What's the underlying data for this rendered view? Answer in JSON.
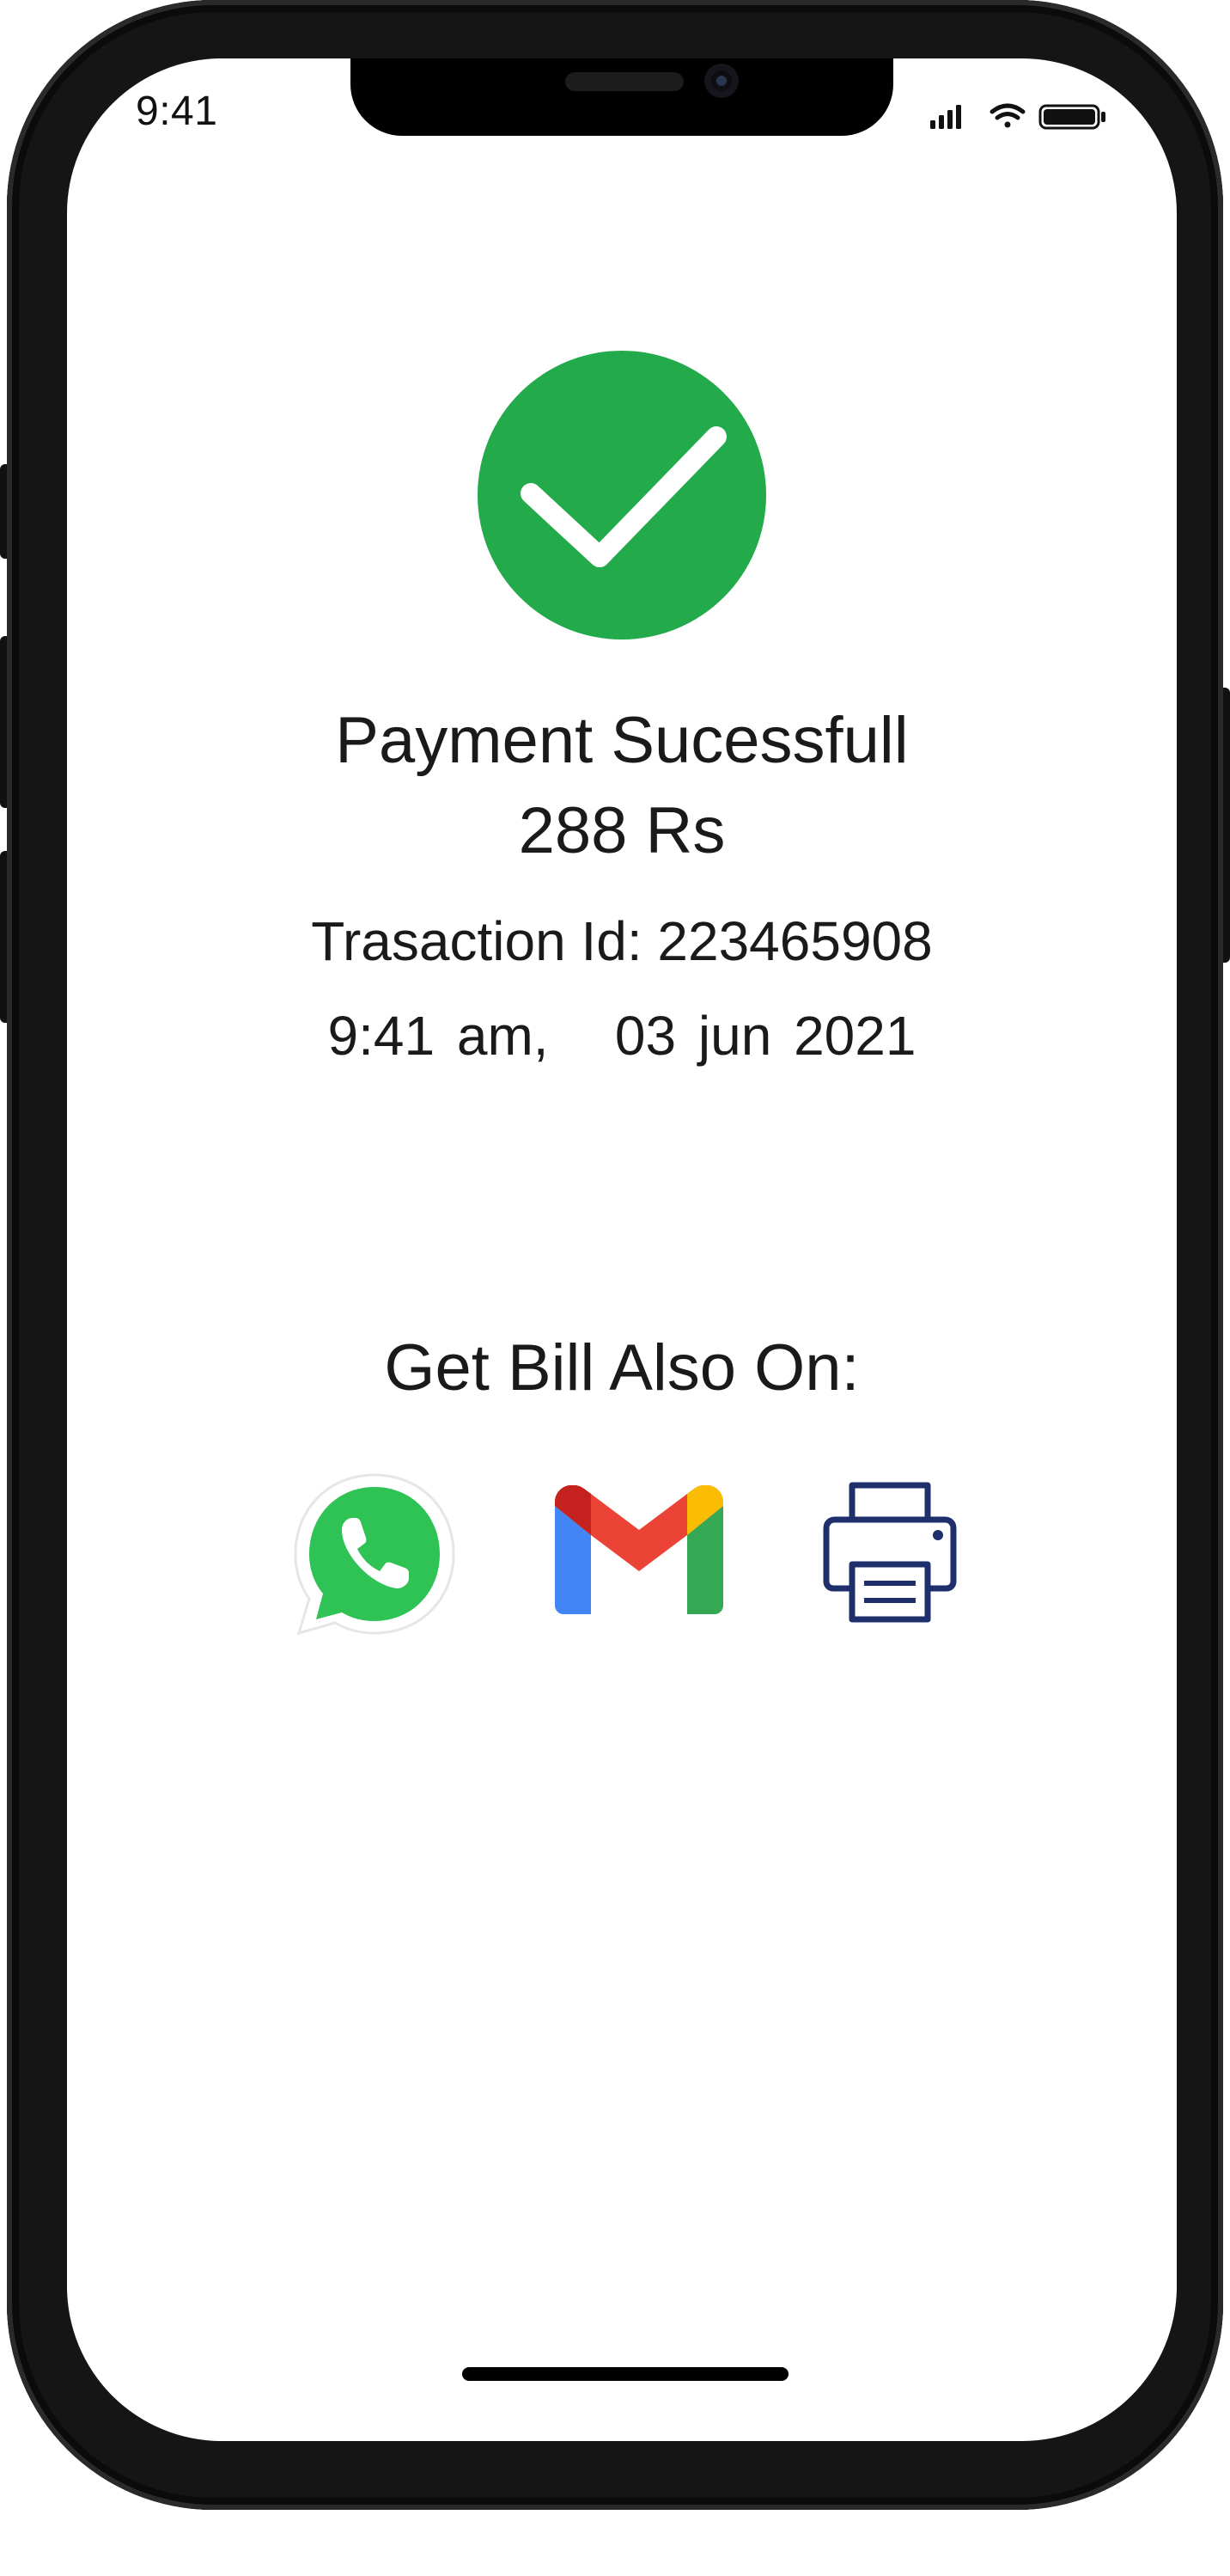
{
  "status_bar": {
    "time": "9:41",
    "icons": [
      "cellular-signal-icon",
      "wifi-icon",
      "battery-icon"
    ]
  },
  "payment": {
    "status_icon": "checkmark-circle-icon",
    "status_color": "#22AA4B",
    "title": "Payment Sucessfull",
    "amount": "288 Rs",
    "transaction": "Trasaction Id: 223465908",
    "datetime": "9:41 am,   03 jun 2021"
  },
  "share": {
    "heading": "Get Bill Also On:",
    "options": [
      {
        "name": "whatsapp",
        "icon": "whatsapp-icon",
        "color": "#25D366"
      },
      {
        "name": "gmail",
        "icon": "gmail-icon",
        "color": "#EA4335"
      },
      {
        "name": "print",
        "icon": "printer-icon",
        "color": "#1F2F6B"
      }
    ]
  }
}
